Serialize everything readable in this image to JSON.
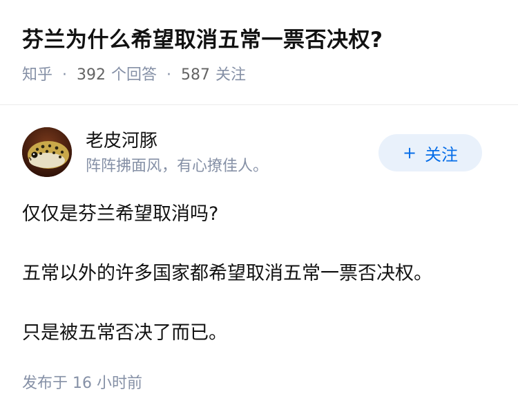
{
  "question": {
    "title": "芬兰为什么希望取消五常一票否决权?",
    "source": "知乎",
    "answer_count": "392",
    "answer_label": "个回答",
    "follow_count": "587",
    "follow_label": "关注",
    "separator": "·"
  },
  "author": {
    "name": "老皮河豚",
    "bio": "阵阵拂面风，有心撩佳人。",
    "avatar_icon": "pufferfish-avatar",
    "follow_plus": "+",
    "follow_label": "关注"
  },
  "answer": {
    "paragraphs": [
      "仅仅是芬兰希望取消吗?",
      "五常以外的许多国家都希望取消五常一票否决权。",
      "只是被五常否决了而已。"
    ],
    "published": "发布于  16 小时前"
  },
  "colors": {
    "accent": "#056de8",
    "follow_bg": "#e9f1fb",
    "meta_text": "#8590a6",
    "primary_text": "#121212"
  }
}
